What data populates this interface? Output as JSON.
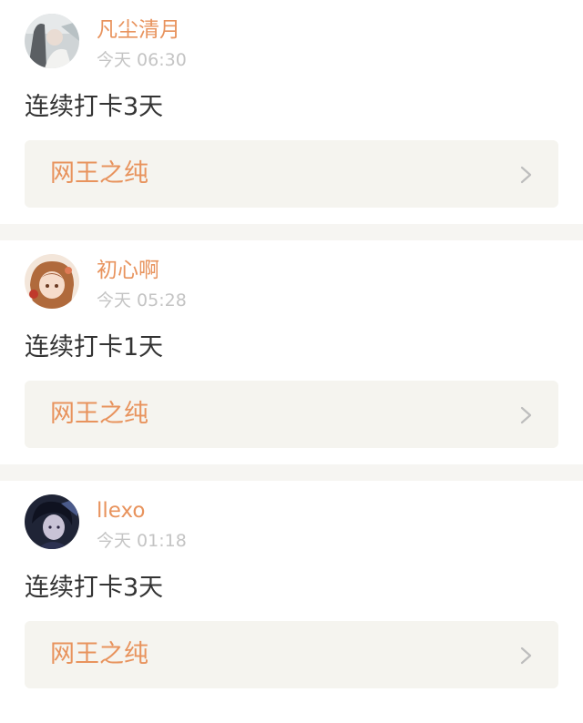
{
  "posts": [
    {
      "username": "凡尘清月",
      "time": "今天 06:30",
      "checkin_text": "连续打卡3天",
      "topic": "网王之纯"
    },
    {
      "username": "初心啊",
      "time": "今天 05:28",
      "checkin_text": "连续打卡1天",
      "topic": "网王之纯"
    },
    {
      "username": "llexo",
      "time": "今天 01:18",
      "checkin_text": "连续打卡3天",
      "topic": "网王之纯"
    }
  ],
  "colors": {
    "accent": "#e8935d",
    "timestamp": "#c4c4c4",
    "topic_bg": "#f5f4ef",
    "separator": "#f6f5f2"
  },
  "icons": {
    "topic_arrow": "chevron-right-icon"
  }
}
